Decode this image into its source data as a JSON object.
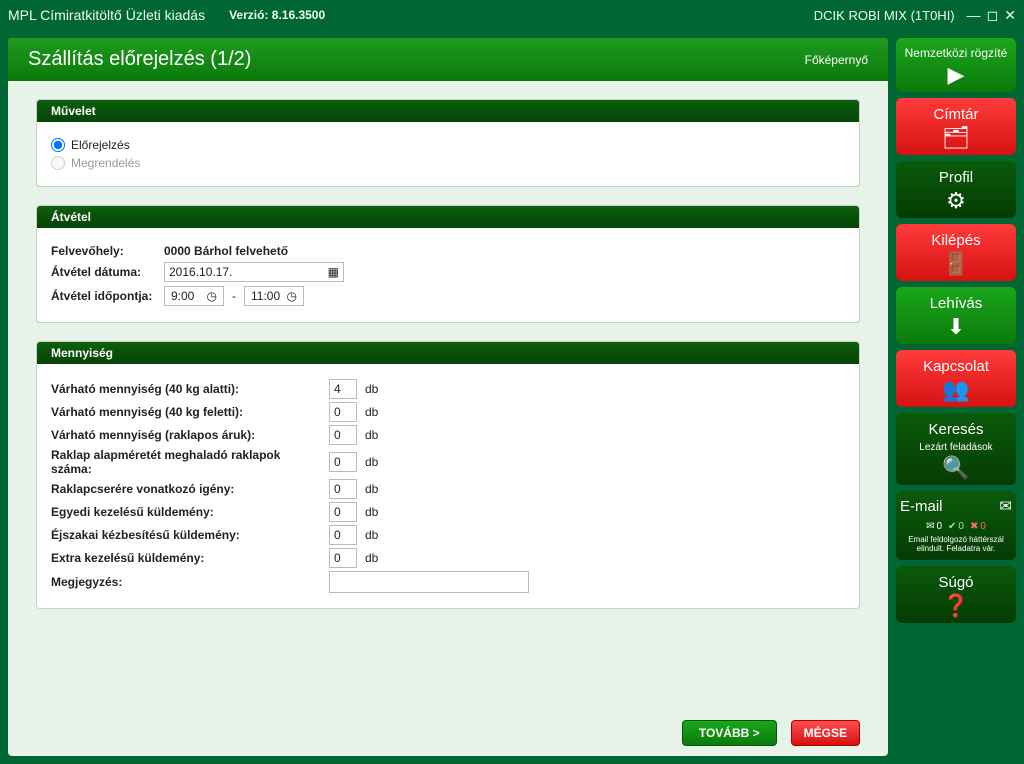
{
  "titlebar": {
    "app_title": "MPL Címiratkitöltő Üzleti kiadás",
    "version_label": "Verzió: 8.16.3500",
    "user_label": "DCIK ROBI MIX (1T0HI)"
  },
  "header": {
    "page_title": "Szállítás előrejelzés (1/2)",
    "home_link": "Főképernyő"
  },
  "panels": {
    "muvelet": {
      "title": "Művelet",
      "opt1": "Előrejelzés",
      "opt2": "Megrendelés"
    },
    "atvetel": {
      "title": "Átvétel",
      "pickup_label": "Felvevőhely:",
      "pickup_value": "0000 Bárhol felvehető",
      "date_label": "Átvétel dátuma:",
      "date_value": "2016.10.17.",
      "time_label": "Átvétel időpontja:",
      "time_from": "9:00",
      "time_sep": "-",
      "time_to": "11:00"
    },
    "mennyiseg": {
      "title": "Mennyiség",
      "unit": "db",
      "rows": [
        {
          "label": "Várható mennyiség (40 kg alatti):",
          "value": "4"
        },
        {
          "label": "Várható mennyiség (40 kg feletti):",
          "value": "0"
        },
        {
          "label": "Várható mennyiség (raklapos áruk):",
          "value": "0"
        },
        {
          "label": "Raklap alapméretét meghaladó raklapok száma:",
          "value": "0"
        },
        {
          "label": "Raklapcserére vonatkozó igény:",
          "value": "0"
        },
        {
          "label": "Egyedi kezelésű küldemény:",
          "value": "0"
        },
        {
          "label": "Éjszakai kézbesítésű küldemény:",
          "value": "0"
        },
        {
          "label": "Extra kezelésű küldemény:",
          "value": "0"
        }
      ],
      "note_label": "Megjegyzés:",
      "note_value": ""
    }
  },
  "footer": {
    "next": "TOVÁBB >",
    "cancel": "MÉGSE"
  },
  "sidebar": {
    "intl": "Nemzetközi rögzíté",
    "cimtar": "Címtár",
    "profil": "Profil",
    "kilepes": "Kilépés",
    "lehivas": "Lehívás",
    "kapcsolat": "Kapcsolat",
    "kereses": "Keresés",
    "kereses_sub": "Lezárt feladások",
    "email": "E-mail",
    "email_counts": {
      "sent": "0",
      "ok": "0",
      "fail": "0"
    },
    "email_sub": "Email feldolgozó háttérszál elindult. Feladatra vár.",
    "sugo": "Súgó"
  }
}
